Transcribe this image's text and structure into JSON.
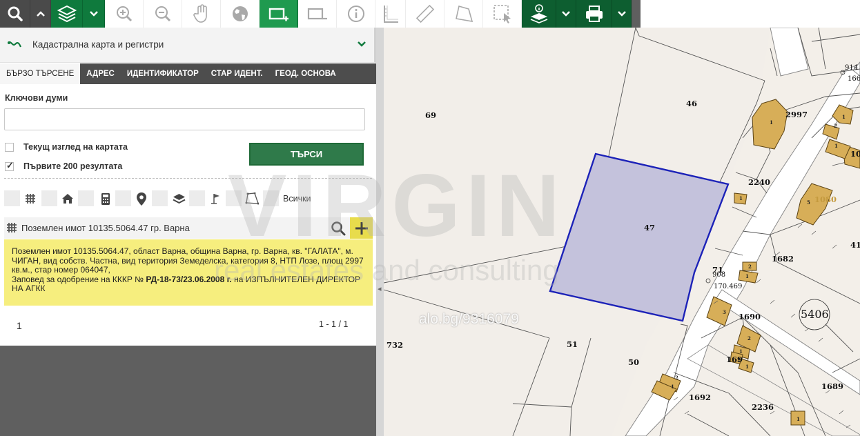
{
  "panel": {
    "layer_title": "Кадастрална карта и регистри",
    "tabs": [
      "БЪРЗО ТЪРСЕНЕ",
      "АДРЕС",
      "ИДЕНТИФИКАТОР",
      "СТАР ИДЕНТ.",
      "ГЕОД. ОСНОВА"
    ],
    "active_tab": "БЪРЗО ТЪРСЕНЕ",
    "keywords_label": "Ключови думи",
    "keywords_value": "",
    "current_view_label": "Текущ изглед на картата",
    "current_view_checked": false,
    "first200_label": "Първите 200 резултата",
    "first200_checked": true,
    "search_button": "ТЪРСИ",
    "filters": [
      "parcel-icon",
      "building-icon",
      "home-icon",
      "calculator-icon",
      "location-pin-icon",
      "layers-icon",
      "flag-icon",
      "polygon-icon"
    ],
    "filter_all_label": "Всички"
  },
  "result": {
    "title": "Поземлен имот 10135.5064.47 гр. Варна",
    "info_line1": "Поземлен имот 10135.5064.47, област Варна, община Варна, гр. Варна, кв. \"ГАЛАТА\", м. ЧИГАН, вид собств. Частна, вид територия Земеделска, категория 8, НТП Лозе, площ 2997 кв.м., стар номер 064047,",
    "info_order_prefix": "Заповед за одобрение на КККР №",
    "info_order_number": "РД-18-73/23.06.2008 г.",
    "info_order_suffix": "на ИЗПЪЛНИТЕЛЕН ДИРЕКТОР НА АГКК",
    "page": "1",
    "count": "1 - 1 / 1"
  },
  "toolbar": {
    "tools": [
      "search-icon",
      "collapse-icon",
      "layers-icon",
      "layers-dropdown-icon",
      "zoom-in-icon",
      "zoom-out-icon",
      "pan-hand-icon",
      "globe-icon",
      "add-rectangle-icon",
      "remove-rectangle-icon",
      "info-icon",
      "measure-angle-icon",
      "measure-distance-icon",
      "measure-area-icon",
      "select-area-icon",
      "identify-layers-icon",
      "identify-dropdown-icon",
      "print-icon",
      "print-dropdown-icon"
    ]
  },
  "map": {
    "parcel_labels": [
      "69",
      "46",
      "47",
      "2997",
      "2240",
      "1080",
      "1682",
      "71",
      "908",
      "170.469",
      "1690",
      "5406",
      "732",
      "51",
      "50",
      "169",
      "1692",
      "2236",
      "1689",
      "914",
      "166",
      "10",
      "41"
    ],
    "building_labels": [
      "1",
      "2",
      "3",
      "4",
      "5"
    ],
    "colors": {
      "map_background": "#f2eee9",
      "selected_parcel_fill": "#c4c2dc",
      "selected_parcel_stroke": "#1c22b8",
      "building_fill": "#d7ae58",
      "road_fill": "#ffffff"
    }
  },
  "watermark": {
    "brand": "VIRGIN",
    "tagline": "real estates and consulting",
    "ref": "alo.bg/9316079"
  },
  "colors": {
    "toolbar_green": "#0f7a3d",
    "toolbar_dark": "#4a4a4a",
    "info_box": "#f6ee7e",
    "search_button": "#2f7a4a",
    "tabs_bar": "#4d4d4d"
  }
}
